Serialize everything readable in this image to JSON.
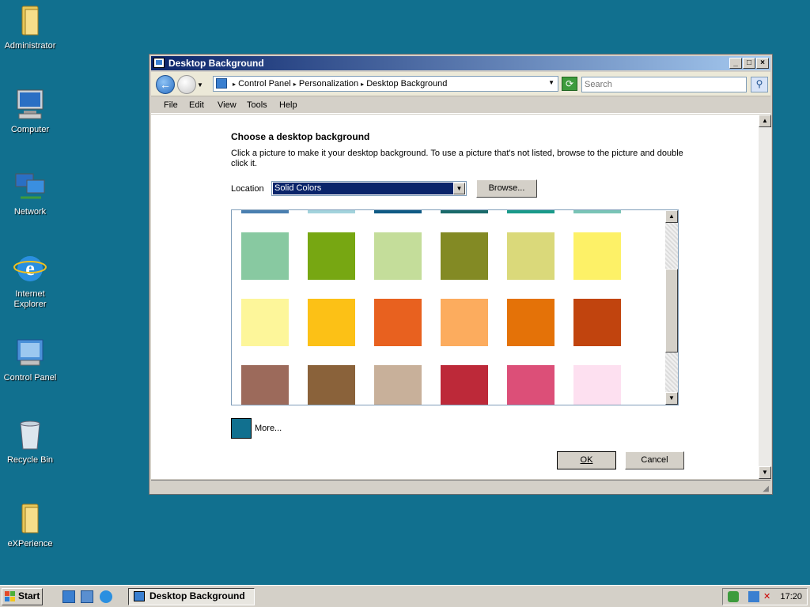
{
  "desktop": {
    "icons": [
      {
        "label": "Administrator",
        "icon": "folder-icon"
      },
      {
        "label": "Computer",
        "icon": "computer-icon"
      },
      {
        "label": "Network",
        "icon": "network-icon"
      },
      {
        "label": "Internet Explorer",
        "icon": "internet-explorer-icon"
      },
      {
        "label": "Control Panel",
        "icon": "control-panel-icon"
      },
      {
        "label": "Recycle Bin",
        "icon": "recycle-bin-icon"
      },
      {
        "label": "eXPerience",
        "icon": "folder-icon"
      }
    ],
    "background_color": "#11708f"
  },
  "window": {
    "title": "Desktop Background",
    "address": {
      "crumbs": [
        "Control Panel",
        "Personalization",
        "Desktop Background"
      ]
    },
    "search": {
      "placeholder": "Search"
    },
    "menu": [
      "File",
      "Edit",
      "View",
      "Tools",
      "Help"
    ],
    "heading": "Choose a desktop background",
    "description": "Click a picture to make it your desktop background. To use a picture that's not listed, browse to the picture and double click it.",
    "location_label": "Location",
    "location_value": "Solid Colors",
    "browse_label": "Browse...",
    "swatches": {
      "partial_top": [
        "#4a7fb0",
        "#a3d3dc",
        "#0f5a84",
        "#1a6a6a",
        "#1a9a8a",
        "#7ac4b6"
      ],
      "rows": [
        [
          "#88c9a1",
          "#77a712",
          "#c4dd9a",
          "#838a24",
          "#dad97a",
          "#fdf167"
        ],
        [
          "#fdf69a",
          "#fcc116",
          "#e8611f",
          "#fcac5e",
          "#e47208",
          "#c1440e"
        ],
        [
          "#9c6a5b",
          "#8a623a",
          "#c8b09a",
          "#bd2939",
          "#dc4f78",
          "#fde0f0"
        ]
      ]
    },
    "selected_color": "#11708f",
    "more_label": "More...",
    "ok_label": "OK",
    "cancel_label": "Cancel"
  },
  "taskbar": {
    "start_label": "Start",
    "task_label": "Desktop Background",
    "clock": "17:20"
  }
}
